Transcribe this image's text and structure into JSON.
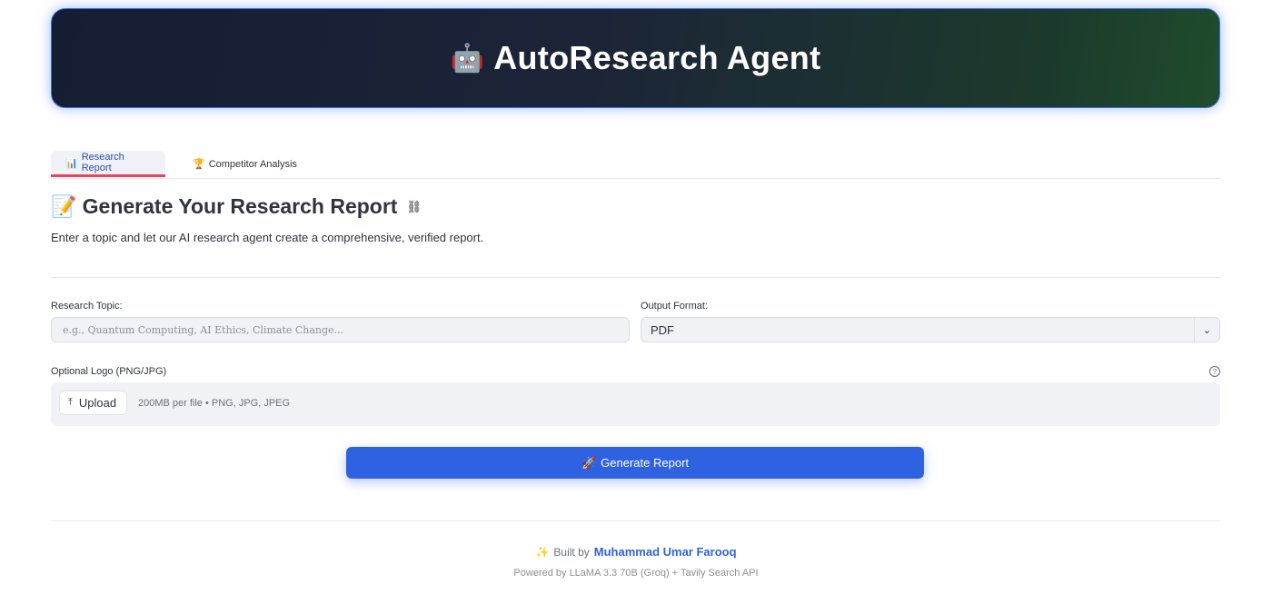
{
  "header": {
    "icon": "robot-icon",
    "emoji": "🤖",
    "title": "AutoResearch Agent",
    "border_color": "#3b6fe0"
  },
  "tabs": [
    {
      "emoji": "📊",
      "label": "Research Report",
      "active": true
    },
    {
      "emoji": "🏆",
      "label": "Competitor Analysis",
      "active": false
    }
  ],
  "section": {
    "emoji": "📝",
    "title": "Generate Your Research Report",
    "link_icon": "link-icon",
    "intro": "Enter a topic and let our AI research agent create a comprehensive, verified report."
  },
  "form": {
    "topic_label": "Research Topic:",
    "topic_placeholder": "e.g., Quantum Computing, AI Ethics, Climate Change...",
    "topic_value": "",
    "format_label": "Output Format:",
    "format_value": "PDF",
    "logo_label": "Optional Logo (PNG/JPG)",
    "upload_label": "Upload",
    "upload_hint": "200MB per file • PNG, JPG, JPEG",
    "generate_emoji": "🚀",
    "generate_label": "Generate Report",
    "accent_color": "#2f62e0"
  },
  "footer": {
    "emoji": "✨",
    "built_by": "Built by",
    "author": "Muhammad Umar Farooq",
    "powered_by": "Powered by LLaMA 3.3 70B (Groq) + Tavily Search API"
  }
}
